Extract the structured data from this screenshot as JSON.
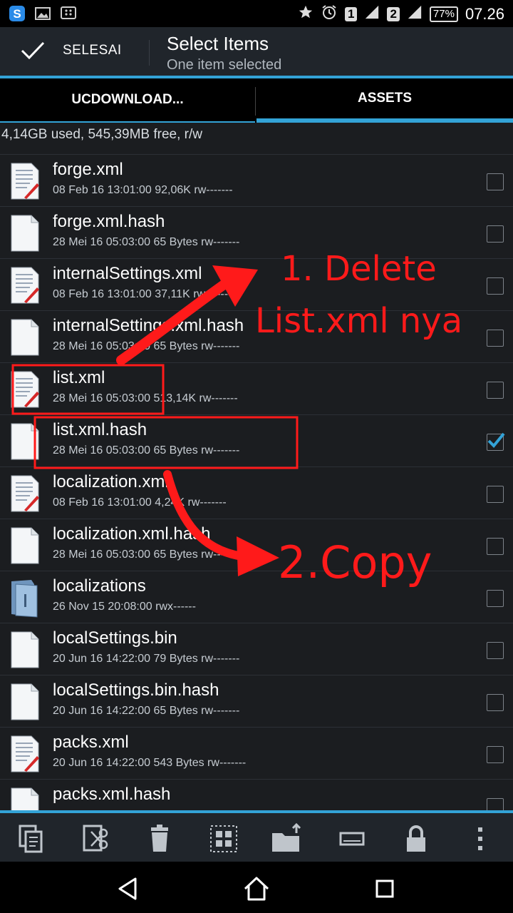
{
  "status_bar": {
    "sim1": "1",
    "sim2": "2",
    "battery": "77%",
    "time": "07.26"
  },
  "action_bar": {
    "done_label": "SELESAI",
    "title": "Select Items",
    "subtitle": "One item selected"
  },
  "tabs": [
    {
      "label": "UCDOWNLOAD...",
      "selected": false
    },
    {
      "label": "ASSETS",
      "selected": true
    }
  ],
  "storage_info": "4,14GB used, 545,39MB free, r/w",
  "files": [
    {
      "name": "forge.xml",
      "date": "08 Feb 16 13:01:00",
      "size": "92,06K",
      "perm": "rw-------",
      "icon": "xml-file-icon",
      "checked": false
    },
    {
      "name": "forge.xml.hash",
      "date": "28 Mei 16 05:03:00",
      "size": "65 Bytes",
      "perm": "rw-------",
      "icon": "blank-file-icon",
      "checked": false
    },
    {
      "name": "internalSettings.xml",
      "date": "08 Feb 16 13:01:00",
      "size": "37,11K",
      "perm": "rw-------",
      "icon": "xml-file-icon",
      "checked": false
    },
    {
      "name": "internalSettings.xml.hash",
      "date": "28 Mei 16 05:03:00",
      "size": "65 Bytes",
      "perm": "rw-------",
      "icon": "blank-file-icon",
      "checked": false
    },
    {
      "name": "list.xml",
      "date": "28 Mei 16 05:03:00",
      "size": "513,14K",
      "perm": "rw-------",
      "icon": "xml-file-icon",
      "checked": false
    },
    {
      "name": "list.xml.hash",
      "date": "28 Mei 16 05:03:00",
      "size": "65 Bytes",
      "perm": "rw-------",
      "icon": "blank-file-icon",
      "checked": true
    },
    {
      "name": "localization.xml",
      "date": "08 Feb 16 13:01:00",
      "size": "4,24K",
      "perm": "rw-------",
      "icon": "xml-file-icon",
      "checked": false
    },
    {
      "name": "localization.xml.hash",
      "date": "28 Mei 16 05:03:00",
      "size": "65 Bytes",
      "perm": "rw-------",
      "icon": "blank-file-icon",
      "checked": false
    },
    {
      "name": "localizations",
      "date": "26 Nov 15 20:08:00",
      "size": "",
      "perm": "rwx------",
      "icon": "folder-icon",
      "checked": false
    },
    {
      "name": "localSettings.bin",
      "date": "20 Jun 16 14:22:00",
      "size": "79 Bytes",
      "perm": "rw-------",
      "icon": "blank-file-icon",
      "checked": false
    },
    {
      "name": "localSettings.bin.hash",
      "date": "20 Jun 16 14:22:00",
      "size": "65 Bytes",
      "perm": "rw-------",
      "icon": "blank-file-icon",
      "checked": false
    },
    {
      "name": "packs.xml",
      "date": "20 Jun 16 14:22:00",
      "size": "543 Bytes",
      "perm": "rw-------",
      "icon": "xml-file-icon",
      "checked": false
    },
    {
      "name": "packs.xml.hash",
      "date": "",
      "size": "",
      "perm": "",
      "icon": "blank-file-icon",
      "checked": false
    }
  ],
  "annotations": {
    "step1_line1": "1. Delete",
    "step1_line2": "List.xml nya",
    "step2": "2.Copy"
  },
  "bottom_toolbar": [
    "copy-icon",
    "cut-icon",
    "trash-icon",
    "select-all-icon",
    "move-folder-icon",
    "rename-icon",
    "lock-icon",
    "more-icon"
  ],
  "nav_bar": [
    "back-icon",
    "home-icon",
    "recents-icon"
  ],
  "colors": {
    "accent": "#33a3d7",
    "annotation_red": "#ff1a1a",
    "background": "#1b1d20",
    "bar": "#20252b"
  }
}
